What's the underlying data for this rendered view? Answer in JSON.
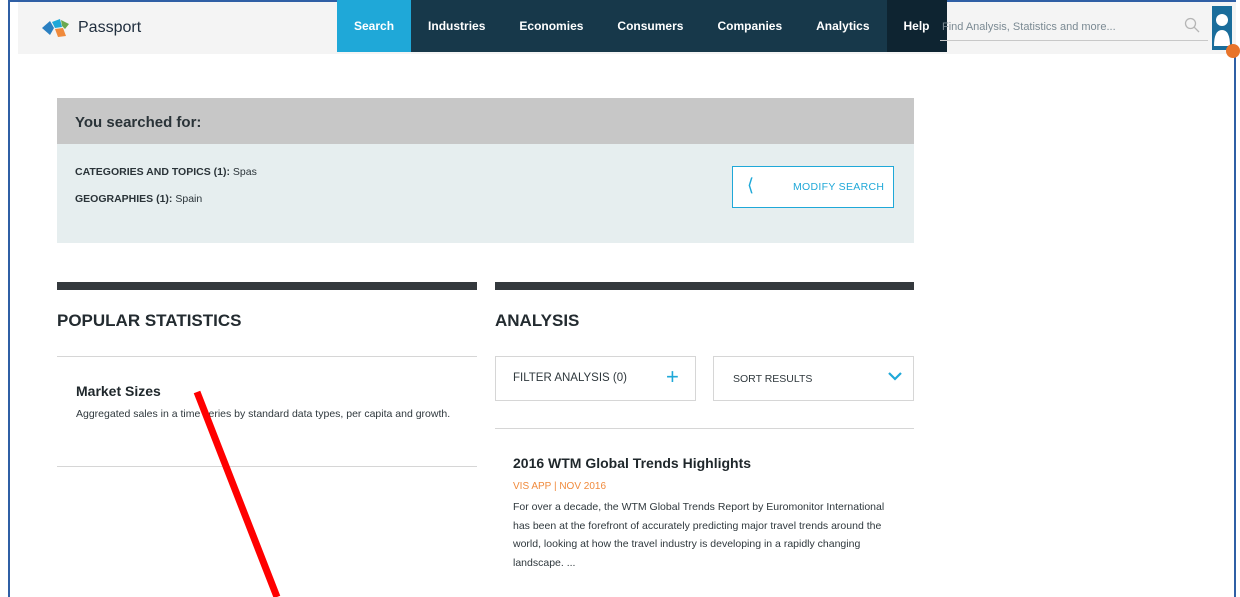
{
  "header": {
    "app_name": "Passport",
    "nav": [
      {
        "label": "Search"
      },
      {
        "label": "Industries"
      },
      {
        "label": "Economies"
      },
      {
        "label": "Consumers"
      },
      {
        "label": "Companies"
      },
      {
        "label": "Analytics"
      },
      {
        "label": "Help"
      }
    ],
    "search_placeholder": "Find Analysis, Statistics and more..."
  },
  "summary": {
    "heading": "You searched for:",
    "categories_label": "CATEGORIES AND TOPICS (1):",
    "categories_value": "Spas",
    "geographies_label": "GEOGRAPHIES (1):",
    "geographies_value": "Spain",
    "modify_button": "MODIFY SEARCH"
  },
  "popular": {
    "title": "POPULAR STATISTICS",
    "item_title": "Market Sizes",
    "item_desc": "Aggregated sales in a time series by standard data types, per capita and growth."
  },
  "analysis": {
    "title": "ANALYSIS",
    "filter_label": "FILTER ANALYSIS (0)",
    "sort_label": "SORT RESULTS",
    "article_title": "2016 WTM Global Trends Highlights",
    "article_meta": "VIS APP | NOV 2016",
    "article_body": "For over a decade, the WTM Global Trends Report by Euromonitor International has been at the forefront of accurately predicting major travel trends around the world, looking at how the travel industry is developing in a rapidly changing landscape. ..."
  },
  "colors": {
    "accent": "#1fa8d8",
    "nav_bg": "#17384a",
    "annotation_arrow": "#ff0000"
  }
}
